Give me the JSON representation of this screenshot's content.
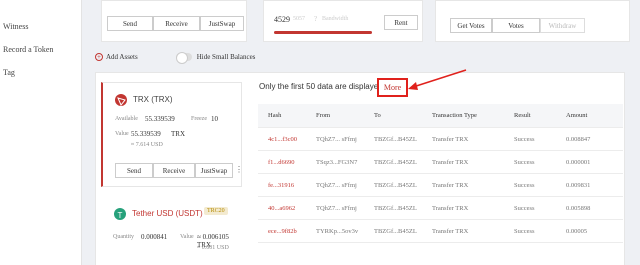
{
  "sidebar": {
    "items": [
      {
        "label": "Witness"
      },
      {
        "label": "Record a Token"
      },
      {
        "label": "Tag"
      }
    ]
  },
  "top_cards": {
    "left_buttons": [
      "Send",
      "Receive",
      "JustSwap"
    ],
    "middle": {
      "value": "4529",
      "sub": "5057",
      "bandwidth_label": "Bandwidth",
      "rent_button": "Rent"
    },
    "right_buttons": [
      "Get Votes",
      "Votes",
      "Withdraw"
    ]
  },
  "assets_bar": {
    "add_assets": "Add Assets",
    "hide_small": "Hide Small Balances"
  },
  "trx_card": {
    "title": "TRX (TRX)",
    "available_label": "Available",
    "available_value": "55.339539",
    "freeze_label": "Freeze",
    "freeze_value": "10",
    "value_label": "Value",
    "value_amount": "55.339539",
    "value_unit": "TRX",
    "usd": "≈ 7.614  USD",
    "buttons": [
      "Send",
      "Receive",
      "JustSwap"
    ],
    "more_icon": "⋮"
  },
  "usdt_card": {
    "title": "Tether USD (USDT)",
    "badge": "TRC20",
    "quantity_label": "Quantity",
    "quantity_value": "0.000841",
    "value_label": "Value",
    "value_amount": "≈ 0.006105 TRX",
    "usd": "≈ 0.001 USD"
  },
  "notice": {
    "text": "Only the first 50 data are displayed",
    "more": "More"
  },
  "table": {
    "headers": [
      "Hash",
      "From",
      "To",
      "Transaction Type",
      "Result",
      "Amount"
    ],
    "rows": [
      [
        "4c1...f3c00",
        "TQhZ7...  sFfmj",
        "TBZGf...B45ZL",
        "Transfer TRX",
        "Success",
        "0.008847"
      ],
      [
        "f1...d6690",
        "TSqz3...FG3N7",
        "TBZGf...B45ZL",
        "Transfer TRX",
        "Success",
        "0.000001"
      ],
      [
        "fe...31916",
        "TQhZ7...  sFfmj",
        "TBZGf...B45ZL",
        "Transfer TRX",
        "Success",
        "0.009831"
      ],
      [
        "40...a6962",
        "TQhZ7...  sFfmj",
        "TBZGf...B45ZL",
        "Transfer TRX",
        "Success",
        "0.005898"
      ],
      [
        "ece...9f82b",
        "TYRKp...5ov3v",
        "TBZGf...B45ZL",
        "Transfer TRX",
        "Success",
        "0.00005"
      ]
    ]
  },
  "colors": {
    "accent": "#c23631",
    "annotation": "#e0211c",
    "usdt": "#26a17b"
  }
}
